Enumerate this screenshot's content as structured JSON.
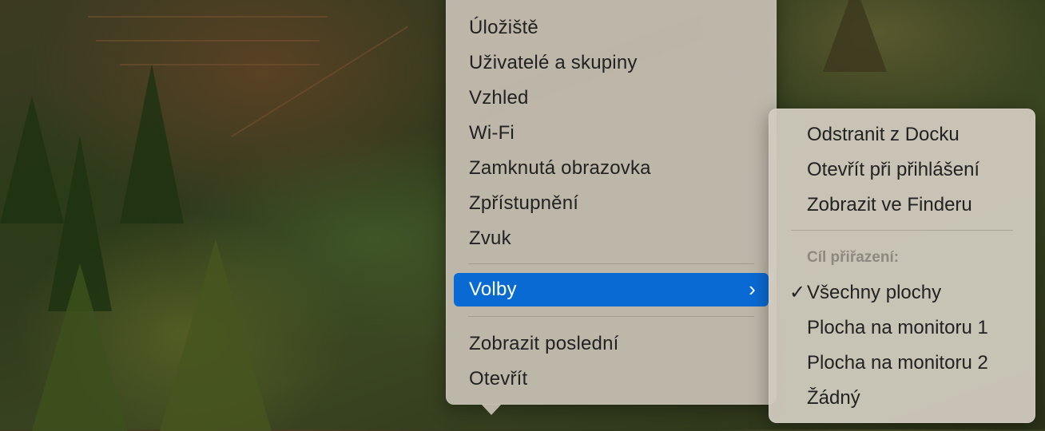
{
  "main_menu": {
    "items_top": [
      {
        "label": "Úložiště"
      },
      {
        "label": "Uživatelé a skupiny"
      },
      {
        "label": "Vzhled"
      },
      {
        "label": "Wi-Fi"
      },
      {
        "label": "Zamknutá obrazovka"
      },
      {
        "label": "Zpřístupnění"
      },
      {
        "label": "Zvuk"
      }
    ],
    "selected_item": {
      "label": "Volby",
      "chevron": "›"
    },
    "items_bottom": [
      {
        "label": "Zobrazit poslední"
      },
      {
        "label": "Otevřít"
      }
    ]
  },
  "submenu": {
    "actions": [
      {
        "label": "Odstranit z Docku"
      },
      {
        "label": "Otevřít při přihlášení"
      },
      {
        "label": "Zobrazit ve Finderu"
      }
    ],
    "assignment_header": "Cíl přiřazení:",
    "assignment_options": [
      {
        "label": "Všechny plochy",
        "checked": true,
        "check": "✓"
      },
      {
        "label": "Plocha na monitoru 1",
        "checked": false
      },
      {
        "label": "Plocha na monitoru 2",
        "checked": false
      },
      {
        "label": "Žádný",
        "checked": false
      }
    ]
  },
  "colors": {
    "selection": "#0a6ad3",
    "menu_bg": "#c6beb2",
    "header_text": "#8d8880"
  }
}
